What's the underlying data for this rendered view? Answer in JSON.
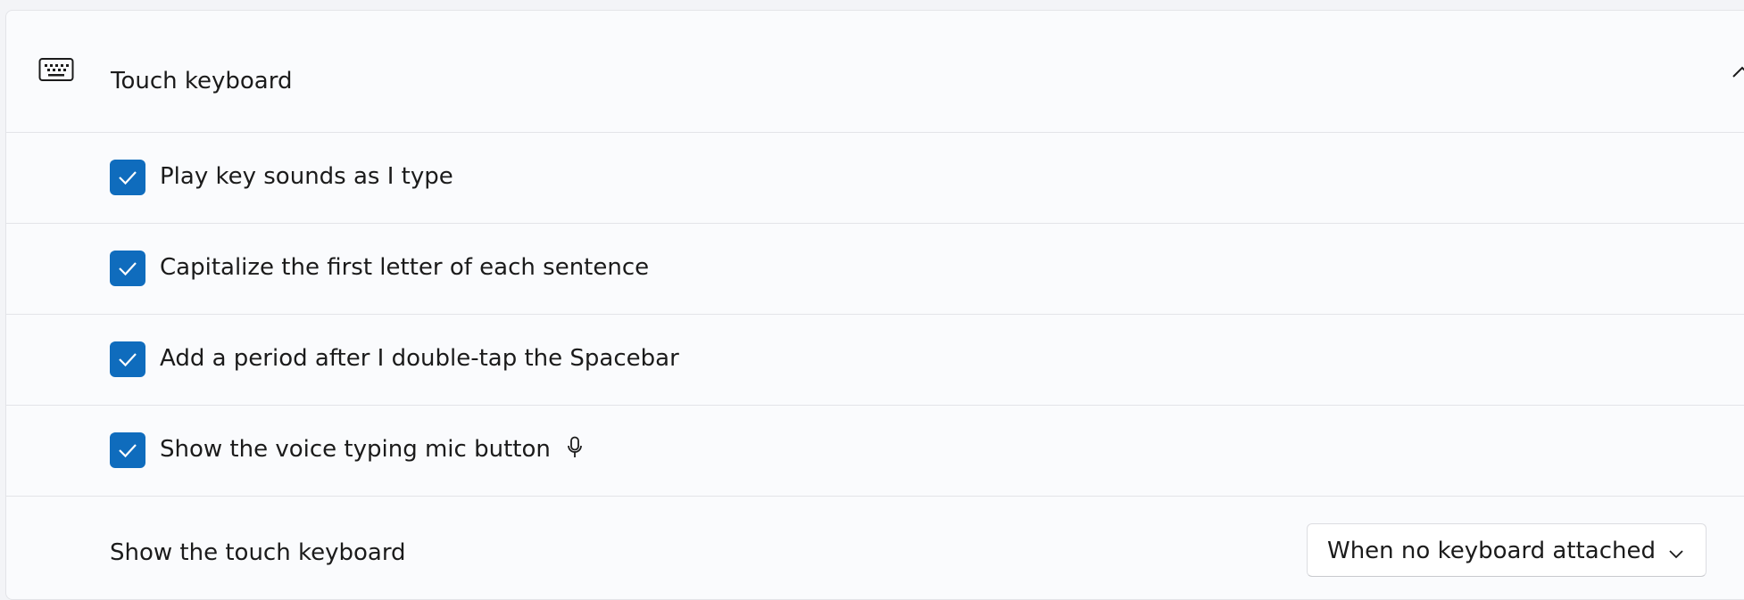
{
  "section": {
    "title": "Touch keyboard",
    "icon": "keyboard-icon",
    "expand_icon": "chevron-up-icon",
    "expanded": true
  },
  "options": [
    {
      "label": "Play key sounds as I type",
      "checked": true
    },
    {
      "label": "Capitalize the first letter of each sentence",
      "checked": true
    },
    {
      "label": "Add a period after I double-tap the Spacebar",
      "checked": true
    },
    {
      "label": "Show the voice typing mic button",
      "checked": true,
      "trailing_icon": "microphone-icon"
    }
  ],
  "show_keyboard": {
    "label": "Show the touch keyboard",
    "selected": "When no keyboard attached",
    "dropdown_icon": "chevron-down-icon"
  },
  "colors": {
    "accent": "#0f6cbd",
    "card_background": "#fafbfd",
    "divider": "#e3e4e8"
  }
}
